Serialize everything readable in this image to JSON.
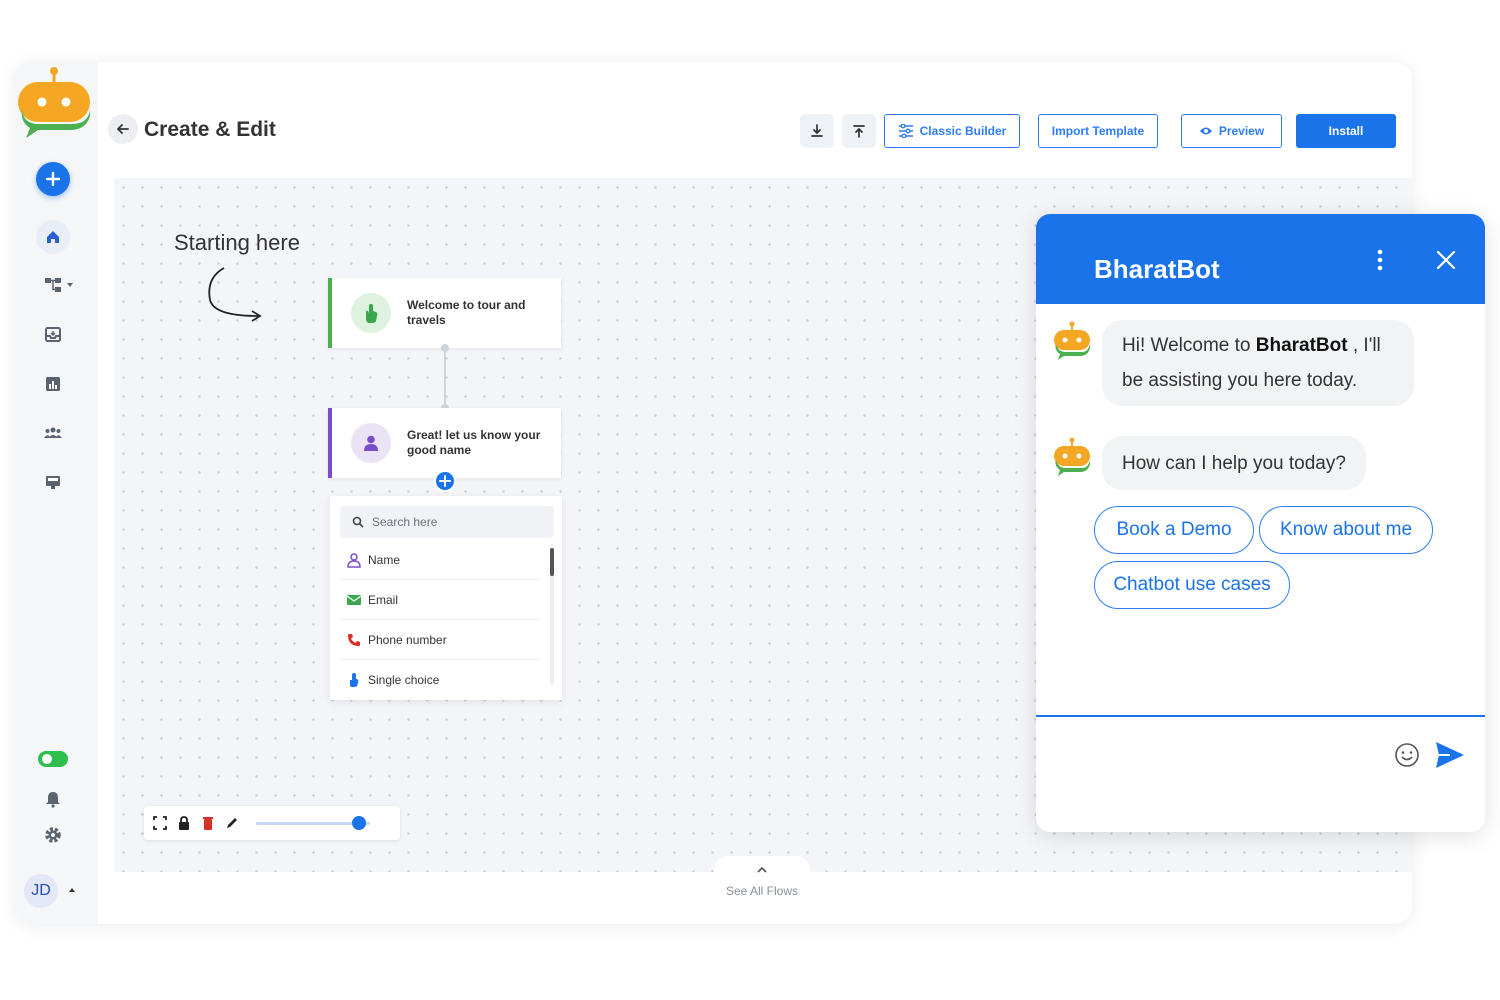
{
  "header": {
    "title": "Create & Edit",
    "buttons": {
      "classic_builder": "Classic Builder",
      "import_template": "Import Template",
      "preview": "Preview",
      "install": "Install"
    }
  },
  "sidebar": {
    "user_initials": "JD",
    "toggle_on": true
  },
  "canvas": {
    "start_label": "Starting here",
    "nodes": [
      {
        "text": "Welcome to tour and travels",
        "icon": "hand-pointer-icon"
      },
      {
        "text": "Great! let us know your good name",
        "icon": "person-icon"
      }
    ],
    "dropdown": {
      "search_placeholder": "Search here",
      "items": [
        {
          "label": "Name",
          "icon": "person-outline-icon"
        },
        {
          "label": "Email",
          "icon": "envelope-icon"
        },
        {
          "label": "Phone number",
          "icon": "phone-icon"
        },
        {
          "label": "Single choice",
          "icon": "single-choice-icon"
        }
      ]
    },
    "zoom_level": 0.9,
    "see_all_label": "See All Flows"
  },
  "chat": {
    "bot_name": "BharatBot",
    "messages": [
      {
        "prefix": "Hi! Welcome to ",
        "bold": "BharatBot",
        "suffix": " , I'll",
        "line2": "be assisting you here today."
      },
      {
        "text": "How can I help you today?"
      }
    ],
    "quick_replies": [
      "Book a Demo",
      "Know about me",
      "Chatbot use cases"
    ],
    "input_placeholder": "",
    "colors": {
      "brand_blue": "#1a73e8",
      "bot_orange": "#f5a623",
      "bot_green": "#4caf50"
    }
  }
}
